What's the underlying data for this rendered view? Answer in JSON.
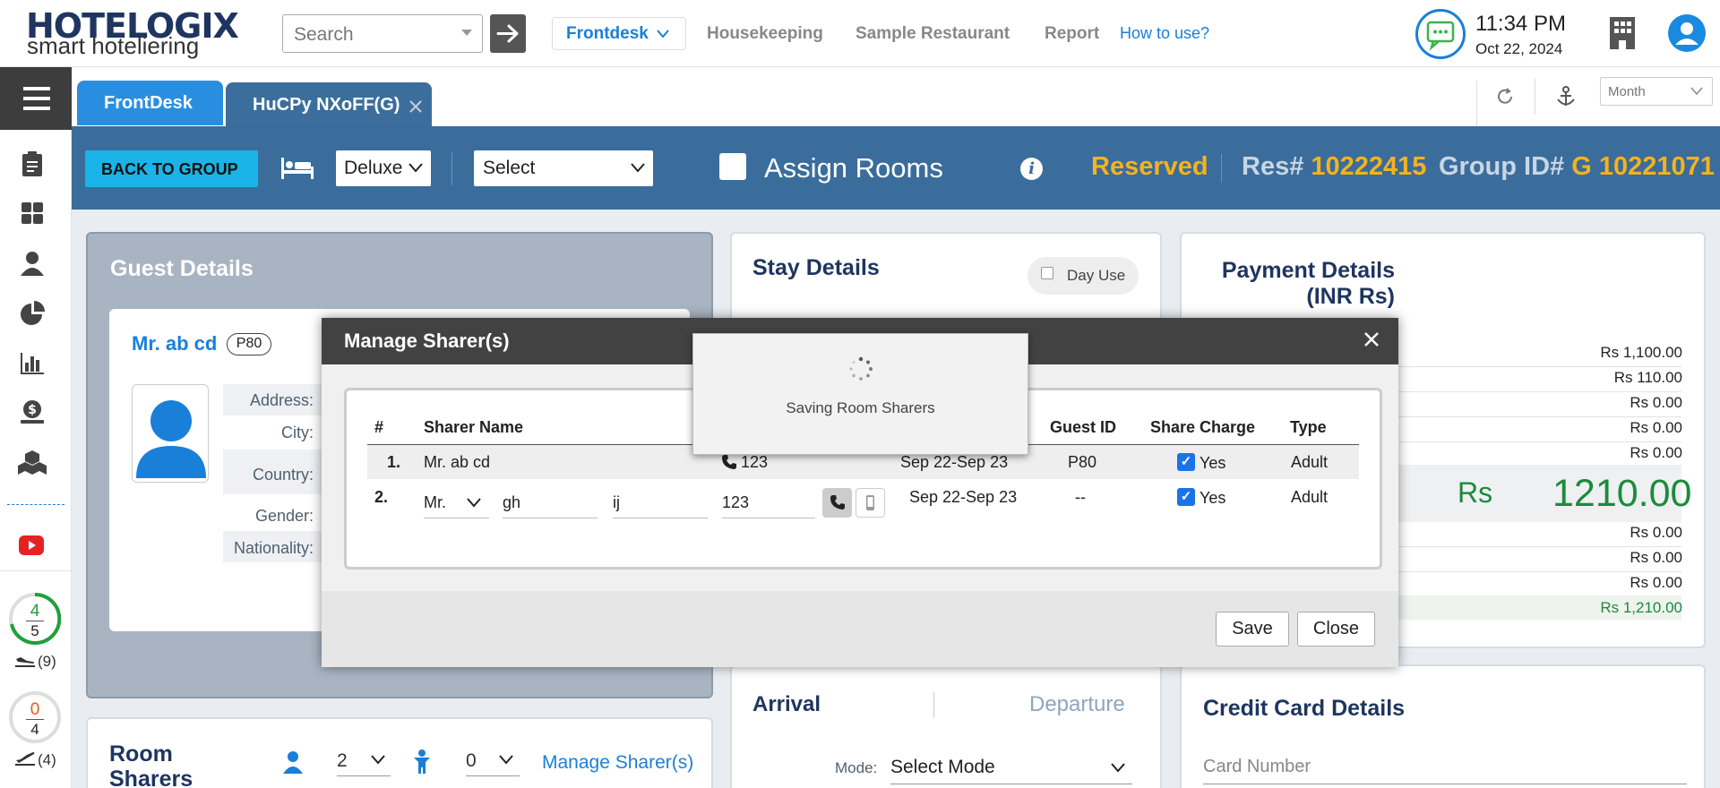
{
  "header": {
    "logo_main": "HOTELOGIX",
    "logo_sub": "smart hoteliering",
    "search_placeholder": "Search",
    "nav": {
      "frontdesk": "Frontdesk",
      "housekeeping": "Housekeeping",
      "restaurant": "Sample Restaurant",
      "report": "Report",
      "help": "How to use?"
    },
    "time": "11:34 PM",
    "date": "Oct 22, 2024"
  },
  "tabs": {
    "frontdesk": "FrontDesk",
    "group": "HuCPy NXoFF(G)",
    "view_select": "Month"
  },
  "toolbar": {
    "back_label": "BACK TO GROUP",
    "room_type": "Deluxe",
    "room_select": "Select",
    "assign_rooms": "Assign Rooms",
    "status": "Reserved",
    "res_label": "Res#",
    "res_no": "10222415",
    "group_label": "Group ID#",
    "group_no": "G 10221071"
  },
  "guest": {
    "title": "Guest Details",
    "name": "Mr. ab cd",
    "id_badge": "P80",
    "fields": [
      "Address:",
      "City:",
      "Country:",
      "Gender:",
      "Nationality:"
    ]
  },
  "stay": {
    "title": "Stay Details",
    "day_use": "Day Use"
  },
  "payment": {
    "title_line1": "Payment Details",
    "title_line2": "(INR Rs)",
    "amounts": [
      "Rs 1,100.00",
      "Rs 110.00",
      "Rs 0.00",
      "Rs 0.00",
      "Rs 0.00"
    ],
    "total_currency": "Rs",
    "total_value": "1210.00",
    "amounts_after": [
      "Rs 0.00",
      "Rs 0.00",
      "Rs 0.00"
    ],
    "grand_total": "Rs 1,210.00"
  },
  "arrival": {
    "arrival_label": "Arrival",
    "departure_label": "Departure",
    "mode_label": "Mode:",
    "mode_value": "Select Mode"
  },
  "credit_card": {
    "title": "Credit Card Details",
    "card_placeholder": "Card Number"
  },
  "room_sharers": {
    "title": "Room Sharers",
    "adults": "2",
    "children": "0",
    "manage_link": "Manage Sharer(s)"
  },
  "sidebar": {
    "arrivals_done": "4",
    "arrivals_total": "5",
    "arrivals_count": "(9)",
    "departures_done": "0",
    "departures_total": "4",
    "departures_count": "(4)"
  },
  "modal": {
    "title": "Manage Sharer(s)",
    "columns": [
      "#",
      "Sharer Name",
      "Guest ID",
      "Share Charge",
      "Type"
    ],
    "rows": [
      {
        "no": "1.",
        "name": "Mr. ab cd",
        "phone": "123",
        "dates": "Sep 22-Sep 23",
        "guest_id": "P80",
        "share": "Yes",
        "type": "Adult"
      },
      {
        "no": "2.",
        "salutation": "Mr.",
        "first": "gh",
        "last": "ij",
        "phone": "123",
        "dates": "Sep 22-Sep 23",
        "guest_id": "--",
        "share": "Yes",
        "type": "Adult"
      }
    ],
    "save_label": "Save",
    "close_label": "Close",
    "saving_text": "Saving Room Sharers"
  },
  "colors": {
    "brand_blue": "#1a7fd8",
    "toolbar_blue": "#3a6d9b",
    "status_orange": "#f6b21d",
    "total_green": "#1c8a3c"
  }
}
